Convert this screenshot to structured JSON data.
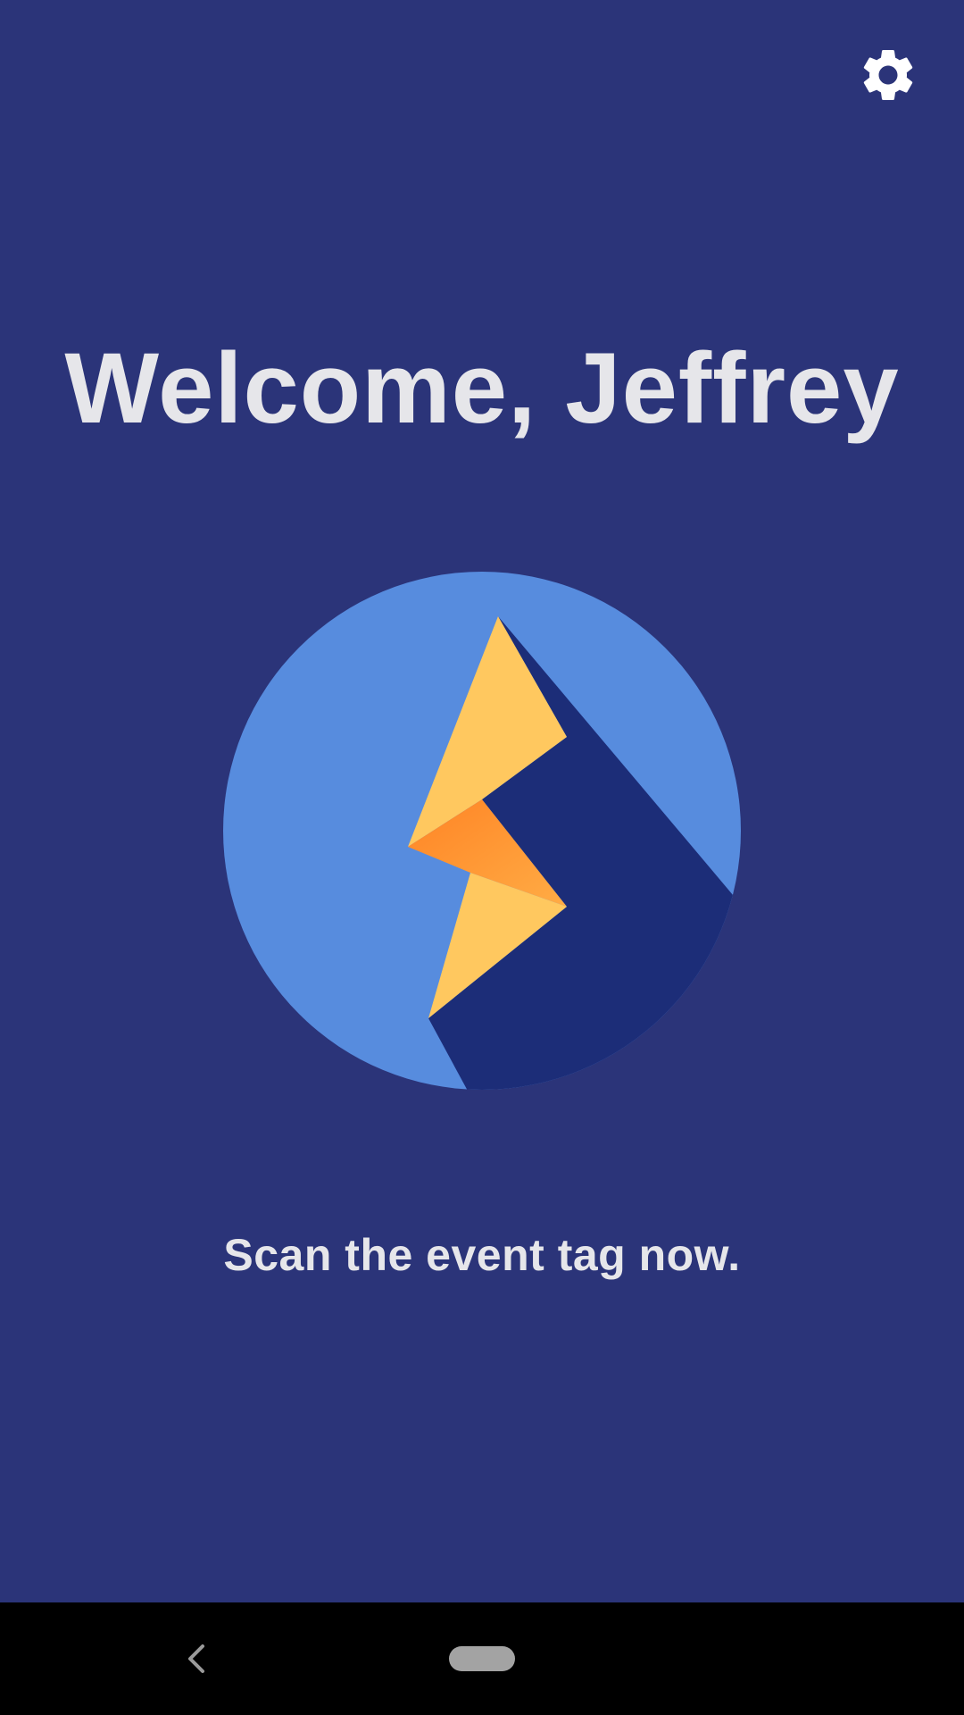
{
  "header": {
    "settings_icon": "gear-icon"
  },
  "main": {
    "title": "Welcome, Jeffrey",
    "logo_icon": "lightning-bolt-logo",
    "instruction": "Scan the event tag now."
  },
  "nav_bar": {
    "back_icon": "chevron-left-icon",
    "home_icon": "home-pill"
  },
  "colors": {
    "background": "#2b3479",
    "circle": "#578cde",
    "shadow": "#1c2d78",
    "bolt_yellow": "#ffc85f",
    "bolt_orange": "#ff8425",
    "text": "#e6e6ea"
  }
}
